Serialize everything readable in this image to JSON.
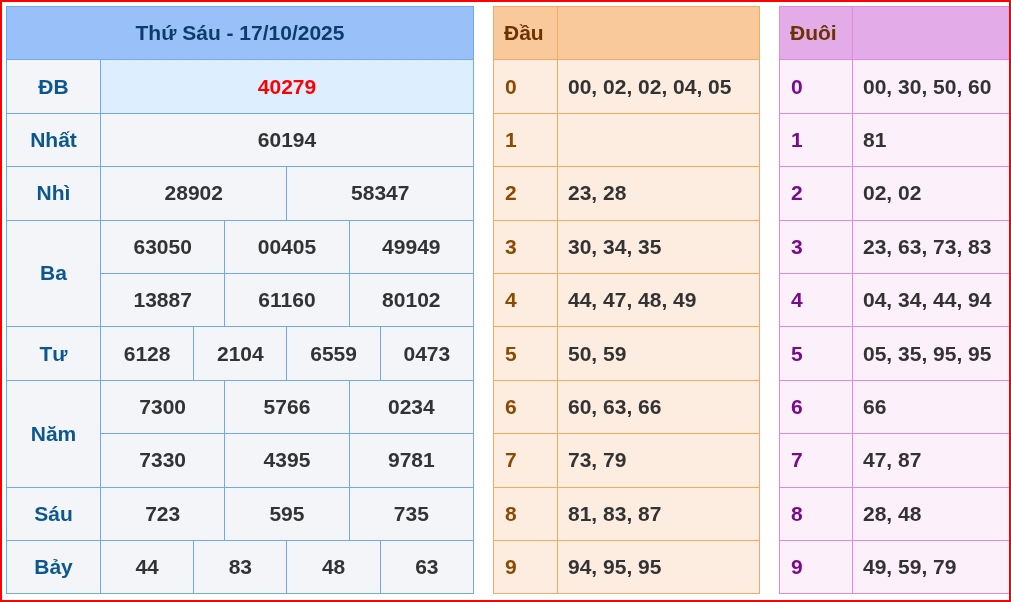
{
  "results": {
    "title": "Thứ Sáu - 17/10/2025",
    "prizes": [
      {
        "label": "ĐB",
        "kind": "special",
        "rows": [
          [
            "40279"
          ]
        ]
      },
      {
        "label": "Nhất",
        "kind": "normal",
        "rows": [
          [
            "60194"
          ]
        ]
      },
      {
        "label": "Nhì",
        "kind": "normal",
        "rows": [
          [
            "28902",
            "58347"
          ]
        ]
      },
      {
        "label": "Ba",
        "kind": "normal",
        "rows": [
          [
            "63050",
            "00405",
            "49949"
          ],
          [
            "13887",
            "61160",
            "80102"
          ]
        ]
      },
      {
        "label": "Tư",
        "kind": "normal",
        "rows": [
          [
            "6128",
            "2104",
            "6559",
            "0473"
          ]
        ]
      },
      {
        "label": "Năm",
        "kind": "normal",
        "rows": [
          [
            "7300",
            "5766",
            "0234"
          ],
          [
            "7330",
            "4395",
            "9781"
          ]
        ]
      },
      {
        "label": "Sáu",
        "kind": "normal",
        "rows": [
          [
            "723",
            "595",
            "735"
          ]
        ]
      },
      {
        "label": "Bảy",
        "kind": "normal",
        "rows": [
          [
            "44",
            "83",
            "48",
            "63"
          ]
        ]
      }
    ]
  },
  "head_table": {
    "header": "Đầu",
    "rows": [
      {
        "digit": "0",
        "numbers": "00, 02, 02, 04, 05"
      },
      {
        "digit": "1"
      },
      {
        "digit": "2",
        "numbers": "23, 28"
      },
      {
        "digit": "3",
        "numbers": "30, 34, 35"
      },
      {
        "digit": "4",
        "numbers": "44, 47, 48, 49"
      },
      {
        "digit": "5",
        "numbers": "50, 59"
      },
      {
        "digit": "6",
        "numbers": "60, 63, 66"
      },
      {
        "digit": "7",
        "numbers": "73, 79"
      },
      {
        "digit": "8",
        "numbers": "81, 83, 87"
      },
      {
        "digit": "9",
        "numbers": "94, 95, 95"
      }
    ]
  },
  "tail_table": {
    "header": "Đuôi",
    "rows": [
      {
        "digit": "0",
        "numbers": "00, 30, 50, 60"
      },
      {
        "digit": "1",
        "numbers": "81"
      },
      {
        "digit": "2",
        "numbers": "02, 02"
      },
      {
        "digit": "3",
        "numbers": "23, 63, 73, 83"
      },
      {
        "digit": "4",
        "numbers": "04, 34, 44, 94"
      },
      {
        "digit": "5",
        "numbers": "05, 35, 95, 95"
      },
      {
        "digit": "6",
        "numbers": "66"
      },
      {
        "digit": "7",
        "numbers": "47, 87"
      },
      {
        "digit": "8",
        "numbers": "28, 48"
      },
      {
        "digit": "9",
        "numbers": "49, 59, 79"
      }
    ]
  }
}
